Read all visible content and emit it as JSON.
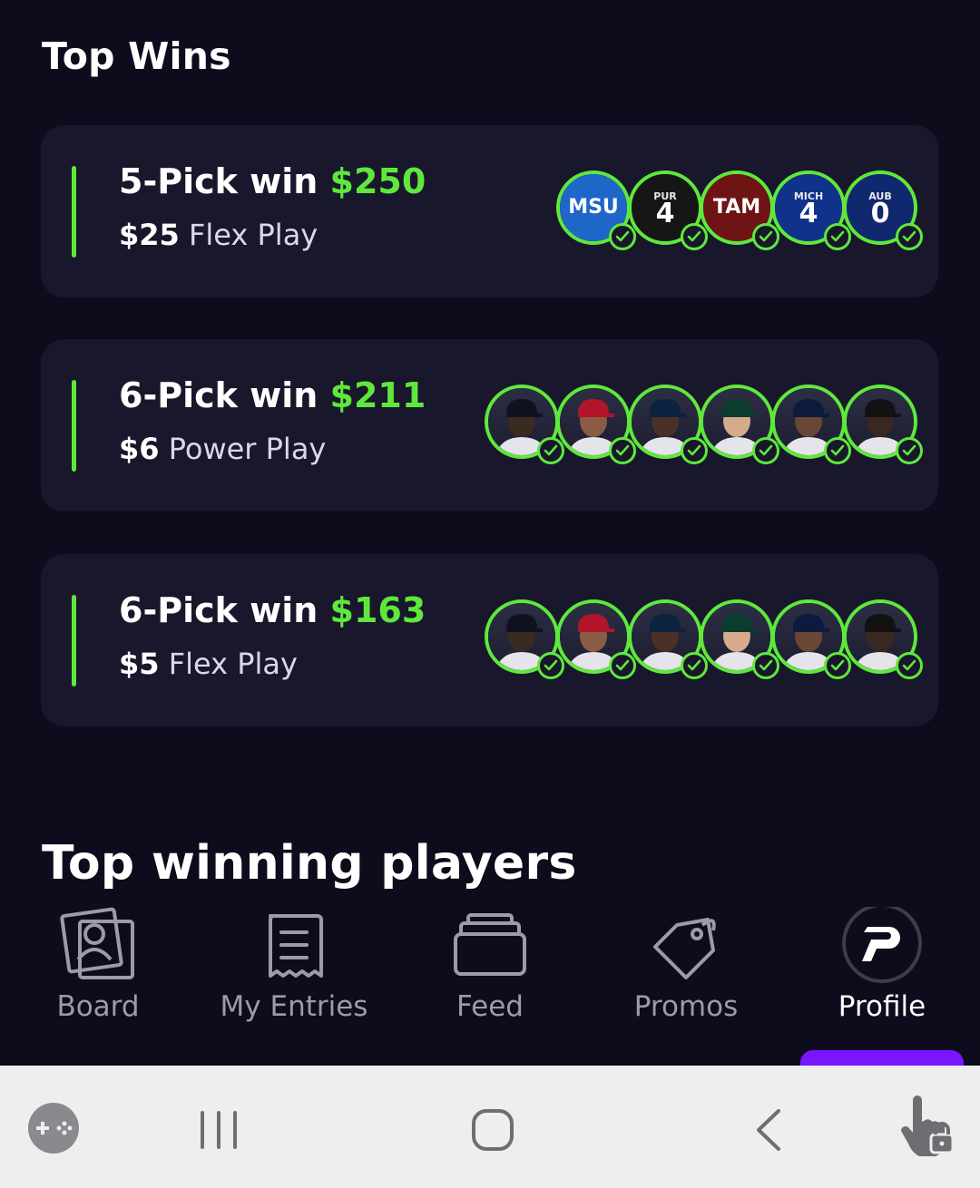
{
  "top_wins": {
    "title": "Top Wins",
    "cards": [
      {
        "pick_label": "5-Pick win",
        "amount": "$250",
        "stake": "$25",
        "play_type": "Flex Play",
        "picks": [
          {
            "kind": "jersey",
            "text": "MSU",
            "color": "#1f66c9"
          },
          {
            "kind": "jersey",
            "top": "PUR",
            "number": "4",
            "color": "#161616"
          },
          {
            "kind": "jersey",
            "text": "TAM",
            "color": "#6f1414"
          },
          {
            "kind": "jersey",
            "top": "MICH",
            "number": "4",
            "color": "#10328a"
          },
          {
            "kind": "jersey",
            "top": "AUB",
            "number": "0",
            "color": "#10286e"
          }
        ]
      },
      {
        "pick_label": "6-Pick win",
        "amount": "$211",
        "stake": "$6",
        "play_type": "Power Play",
        "picks": [
          {
            "kind": "player",
            "skin": "#3b2a22",
            "cap": "#10131f"
          },
          {
            "kind": "player",
            "skin": "#8a5c45",
            "cap": "#b0152a"
          },
          {
            "kind": "player",
            "skin": "#4a3126",
            "cap": "#0c2340"
          },
          {
            "kind": "player",
            "skin": "#d7a98d",
            "cap": "#0b3d2e"
          },
          {
            "kind": "player",
            "skin": "#6a4634",
            "cap": "#0c1b3d"
          },
          {
            "kind": "player",
            "skin": "#3a2720",
            "cap": "#121212"
          }
        ]
      },
      {
        "pick_label": "6-Pick win",
        "amount": "$163",
        "stake": "$5",
        "play_type": "Flex Play",
        "picks": [
          {
            "kind": "player",
            "skin": "#3b2a22",
            "cap": "#10131f"
          },
          {
            "kind": "player",
            "skin": "#8a5c45",
            "cap": "#b0152a"
          },
          {
            "kind": "player",
            "skin": "#4a3126",
            "cap": "#0c2340"
          },
          {
            "kind": "player",
            "skin": "#d7a98d",
            "cap": "#0b3d2e"
          },
          {
            "kind": "player",
            "skin": "#6a4634",
            "cap": "#0c1b3d"
          },
          {
            "kind": "player",
            "skin": "#3a2720",
            "cap": "#121212"
          }
        ]
      }
    ]
  },
  "top_players": {
    "title": "Top winning players"
  },
  "nav": {
    "items": [
      {
        "label": "Board",
        "icon": "board-icon"
      },
      {
        "label": "My Entries",
        "icon": "entries-icon"
      },
      {
        "label": "Feed",
        "icon": "feed-icon"
      },
      {
        "label": "Promos",
        "icon": "promos-icon"
      },
      {
        "label": "Profile",
        "icon": "profile-icon",
        "active": true
      }
    ]
  },
  "colors": {
    "background": "#0d0c1d",
    "card": "#18172b",
    "accent_green": "#5fe83c",
    "active_purple": "#7a16ff"
  },
  "system_bar": {
    "icons": [
      "game-launcher-icon",
      "recents-icon",
      "home-icon",
      "back-icon",
      "touch-lock-icon"
    ]
  }
}
